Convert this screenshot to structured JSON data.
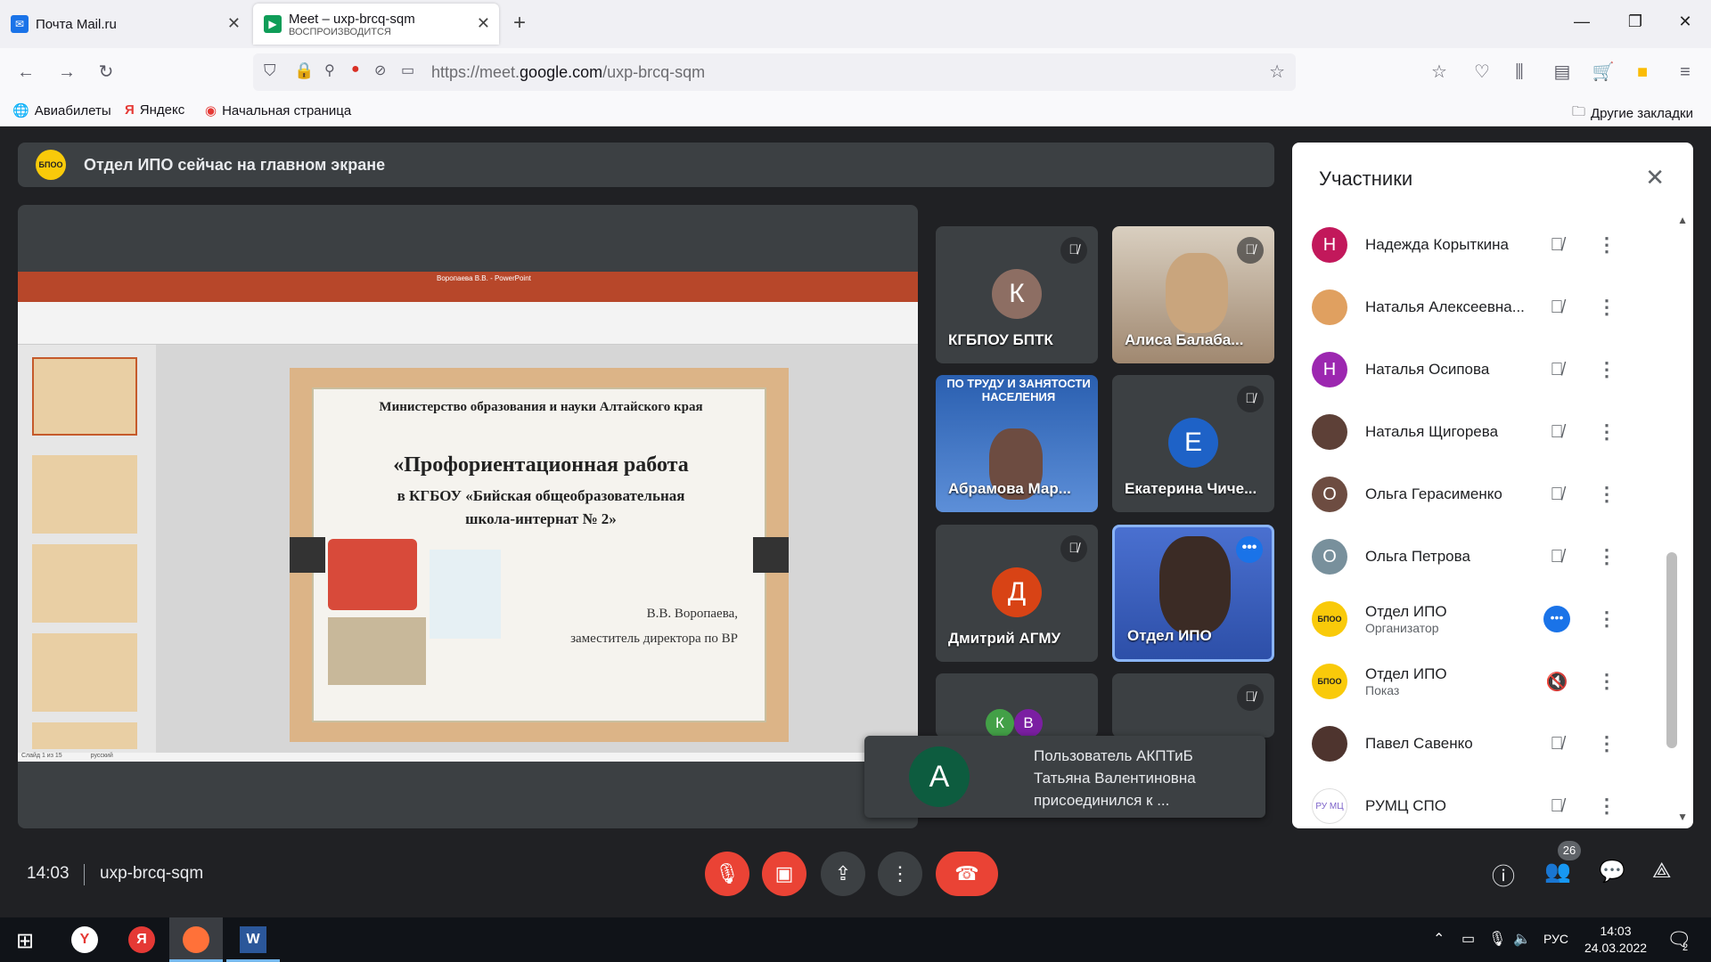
{
  "tabs": [
    {
      "title": "Почта Mail.ru"
    },
    {
      "title": "Meet – uxp-brcq-sqm",
      "subtitle": "ВОСПРОИЗВОДИТСЯ"
    }
  ],
  "url": {
    "prefix": "https://meet.",
    "domain": "google.com",
    "path": "/uxp-brcq-sqm"
  },
  "bookmarks": [
    "Авиабилеты",
    "Яндекс",
    "Начальная страница"
  ],
  "other_bookmarks": "Другие закладки",
  "banner": "Отдел ИПО сейчас на главном экране",
  "slide": {
    "ministry": "Министерство образования и науки Алтайского края",
    "title1": "«Профориентационная работа",
    "title2": "в КГБОУ «Бийская общеобразовательная",
    "title3": "школа-интернат № 2»",
    "author": "В.В. Воропаева,",
    "position": "заместитель директора по ВР"
  },
  "ppt": {
    "window_title": "Воропаева В.В. - PowerPoint",
    "status": "Слайд 1 из 15",
    "lang": "русский"
  },
  "tiles": [
    {
      "name": "КГБПОУ БПТК",
      "initial": "К",
      "color": "#8d6e63"
    },
    {
      "name": "Алиса Балаба...",
      "initial": "",
      "color": "#b99a7e"
    },
    {
      "name": "Абрамова Мар...",
      "initial": "",
      "color": "#2a5fb0"
    },
    {
      "name": "Екатерина Чиче...",
      "initial": "Е",
      "color": "#1e62c7"
    },
    {
      "name": "Дмитрий АГМУ",
      "initial": "Д",
      "color": "#d84315"
    },
    {
      "name": "Отдел ИПО",
      "initial": "",
      "color": "#3a5dc0"
    }
  ],
  "tile_overlay_text": "ПО ТРУДУ И ЗАНЯТОСТИ НАСЕЛЕНИЯ",
  "small_avatars": [
    "К",
    "В"
  ],
  "toast": {
    "initial": "А",
    "text1": "Пользователь АКПТиБ",
    "text2": "Татьяна Валентиновна",
    "text3": "присоединился к ..."
  },
  "panel": {
    "title": "Участники",
    "people": [
      {
        "name": "Надежда Корыткина",
        "initial": "Н",
        "color": "#c2185b",
        "role": ""
      },
      {
        "name": "Наталья Алексеевна...",
        "initial": "",
        "color": "#e0a060",
        "role": ""
      },
      {
        "name": "Наталья Осипова",
        "initial": "Н",
        "color": "#9c27b0",
        "role": ""
      },
      {
        "name": "Наталья Щигорева",
        "initial": "",
        "color": "#5d4037",
        "role": ""
      },
      {
        "name": "Ольга Герасименко",
        "initial": "О",
        "color": "#6d4c41",
        "role": ""
      },
      {
        "name": "Ольга Петрова",
        "initial": "О",
        "color": "#78909c",
        "role": ""
      },
      {
        "name": "Отдел ИПО",
        "initial": "БПОО",
        "color": "#f9ca0a",
        "role": "Организатор"
      },
      {
        "name": "Отдел ИПО",
        "initial": "БПОО",
        "color": "#f9ca0a",
        "role": "Показ"
      },
      {
        "name": "Павел Савенко",
        "initial": "",
        "color": "#4e342e",
        "role": ""
      },
      {
        "name": "РУМЦ СПО",
        "initial": "РУ МЦ",
        "color": "#fff",
        "role": ""
      }
    ]
  },
  "meeting": {
    "time": "14:03",
    "code": "uxp-brcq-sqm",
    "participants_count": "26"
  },
  "taskbar": {
    "lang": "РУС",
    "time": "14:03",
    "date": "24.03.2022",
    "notifications": "2"
  }
}
